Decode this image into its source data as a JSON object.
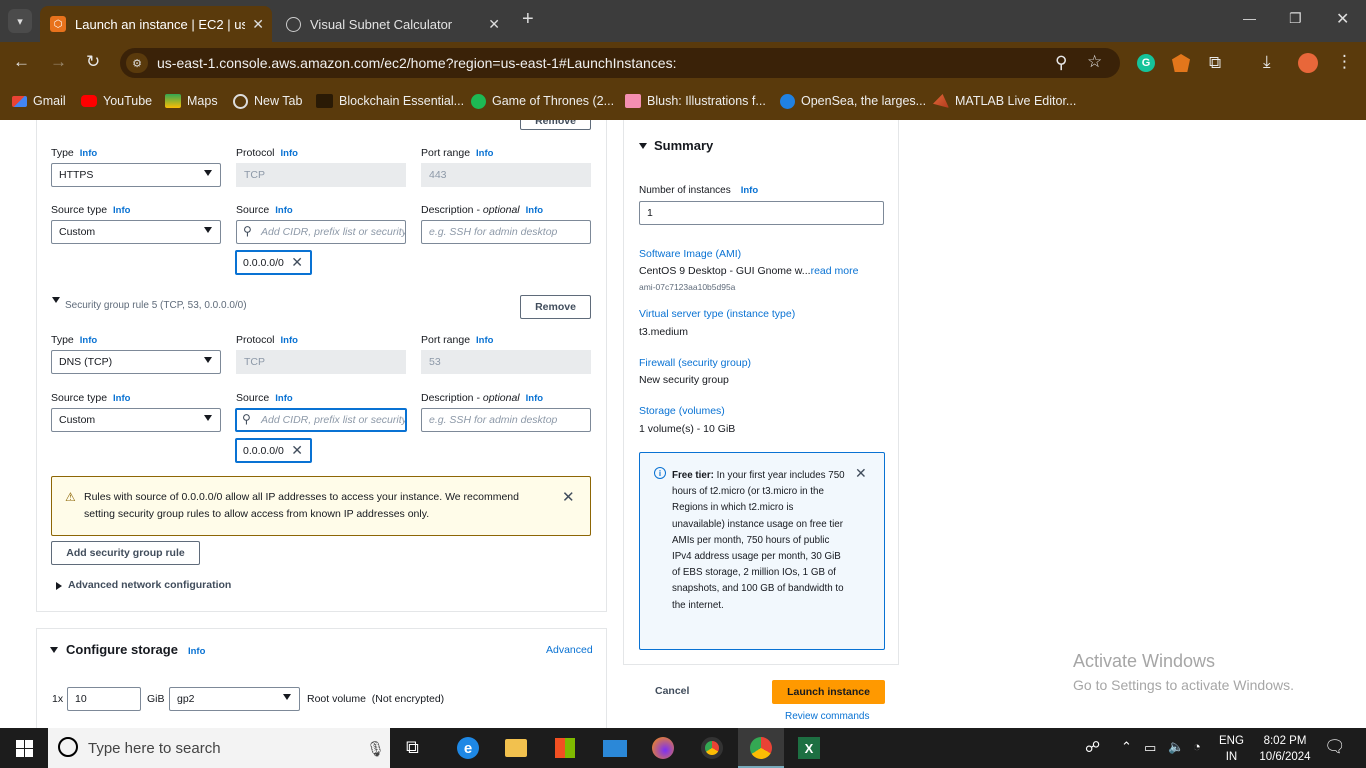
{
  "browser": {
    "tabs": [
      {
        "title": "Launch an instance | EC2 | us-ea",
        "close": "✕"
      },
      {
        "title": "Visual Subnet Calculator",
        "close": "✕"
      }
    ],
    "new_tab": "+",
    "url": "us-east-1.console.aws.amazon.com/ec2/home?region=us-east-1#LaunchInstances:",
    "window_controls": {
      "minimize": "—",
      "restore": "❐",
      "close": "✕"
    },
    "bookmarks": [
      {
        "label": "Gmail"
      },
      {
        "label": "YouTube"
      },
      {
        "label": "Maps"
      },
      {
        "label": "New Tab"
      },
      {
        "label": "Blockchain Essential..."
      },
      {
        "label": "Game of Thrones (2..."
      },
      {
        "label": "Blush: Illustrations f..."
      },
      {
        "label": "OpenSea, the larges..."
      },
      {
        "label": "MATLAB Live Editor..."
      }
    ]
  },
  "network": {
    "top_remove_label": "Remove",
    "rule4": {
      "type_label": "Type",
      "type_info": "Info",
      "type_value": "HTTPS",
      "protocol_label": "Protocol",
      "protocol_info": "Info",
      "protocol_value": "TCP",
      "port_label": "Port range",
      "port_info": "Info",
      "port_value": "443",
      "source_type_label": "Source type",
      "source_type_info": "Info",
      "source_type_value": "Custom",
      "source_label": "Source",
      "source_info": "Info",
      "source_placeholder": "Add CIDR, prefix list or security",
      "desc_label": "Description - ",
      "desc_optional": "optional",
      "desc_info": "Info",
      "desc_placeholder": "e.g. SSH for admin desktop",
      "token": "0.0.0.0/0"
    },
    "rule5": {
      "heading": "Security group rule 5 (TCP, 53, 0.0.0.0/0)",
      "remove_label": "Remove",
      "type_label": "Type",
      "type_info": "Info",
      "type_value": "DNS (TCP)",
      "protocol_label": "Protocol",
      "protocol_info": "Info",
      "protocol_value": "TCP",
      "port_label": "Port range",
      "port_info": "Info",
      "port_value": "53",
      "source_type_label": "Source type",
      "source_type_info": "Info",
      "source_type_value": "Custom",
      "source_label": "Source",
      "source_info": "Info",
      "source_placeholder": "Add CIDR, prefix list or security",
      "desc_label": "Description - ",
      "desc_optional": "optional",
      "desc_info": "Info",
      "desc_placeholder": "e.g. SSH for admin desktop",
      "token": "0.0.0.0/0"
    },
    "warning_text": "Rules with source of 0.0.0.0/0 allow all IP addresses to access your instance. We recommend setting security group rules to allow access from known IP addresses only.",
    "add_rule_label": "Add security group rule",
    "advanced_label": "Advanced network configuration"
  },
  "storage": {
    "title": "Configure storage",
    "info": "Info",
    "advanced": "Advanced",
    "multiplier": "1x",
    "size": "10",
    "unit": "GiB",
    "volume_type": "gp2",
    "root_label": "Root volume",
    "encryption": "(Not encrypted)"
  },
  "summary": {
    "title": "Summary",
    "instances_label": "Number of instances",
    "instances_info": "Info",
    "instances_value": "1",
    "ami_label": "Software Image (AMI)",
    "ami_value": "CentOS 9 Desktop - GUI Gnome w...",
    "ami_more": "read more",
    "ami_id": "ami-07c7123aa10b5d95a",
    "type_label": "Virtual server type (instance type)",
    "type_value": "t3.medium",
    "firewall_label": "Firewall (security group)",
    "firewall_value": "New security group",
    "storage_label": "Storage (volumes)",
    "storage_value": "1 volume(s) - 10 GiB",
    "free_tier_bold": "Free tier:",
    "free_tier_text": " In your first year includes 750 hours of t2.micro (or t3.micro in the Regions in which t2.micro is unavailable) instance usage on free tier AMIs per month, 750 hours of public IPv4 address usage per month, 30 GiB of EBS storage, 2 million IOs, 1 GB of snapshots, and 100 GB of bandwidth to the internet.",
    "cancel": "Cancel",
    "launch": "Launch instance",
    "review": "Review commands"
  },
  "watermark": {
    "title": "Activate Windows",
    "subtitle": "Go to Settings to activate Windows."
  },
  "taskbar": {
    "search_placeholder": "Type here to search",
    "lang": "ENG",
    "region": "IN",
    "time": "8:02 PM",
    "date": "10/6/2024"
  },
  "colors": {
    "accent_orange": "#ff9900",
    "link_blue": "#0972d3",
    "chrome_brown": "#5a3a0c"
  }
}
